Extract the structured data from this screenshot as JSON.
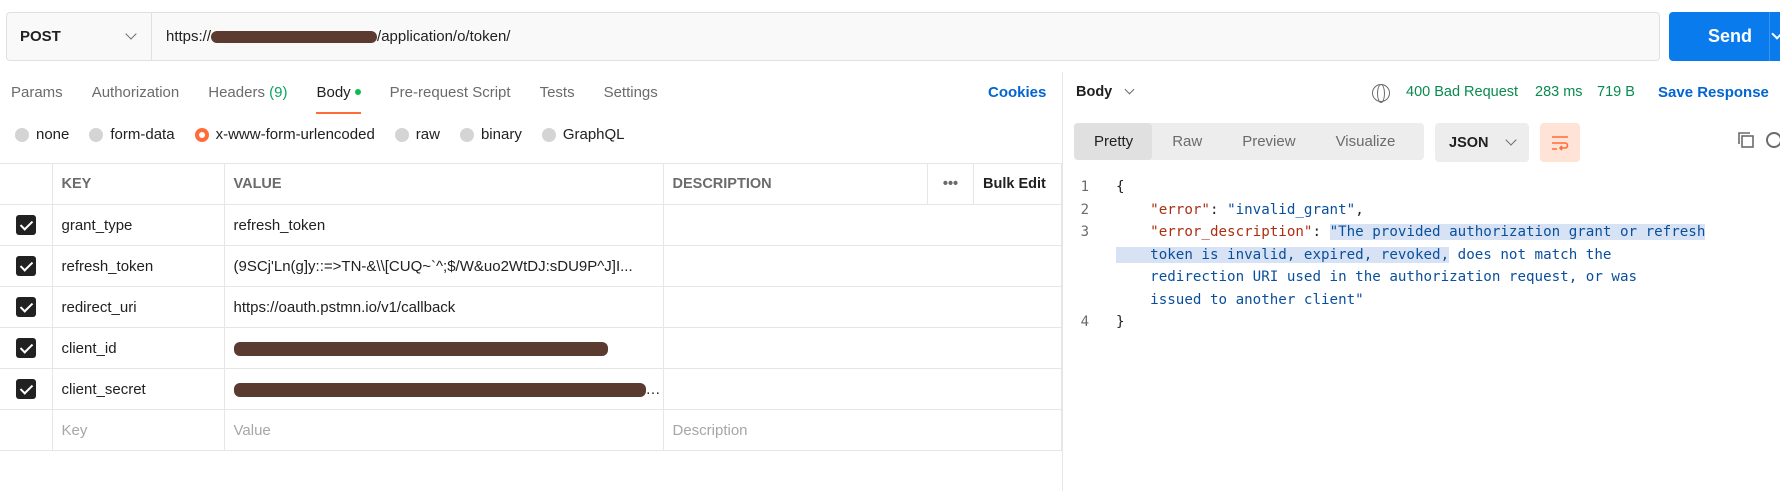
{
  "request": {
    "method": "POST",
    "url_prefix": "https://",
    "url_suffix": "/application/o/token/",
    "send_label": "Send"
  },
  "tabs": {
    "params": "Params",
    "authorization": "Authorization",
    "headers": "Headers",
    "headers_count": "(9)",
    "body": "Body",
    "prerequest": "Pre-request Script",
    "tests": "Tests",
    "settings": "Settings",
    "cookies": "Cookies"
  },
  "body_types": [
    "none",
    "form-data",
    "x-www-form-urlencoded",
    "raw",
    "binary",
    "GraphQL"
  ],
  "body_type_selected": "x-www-form-urlencoded",
  "table": {
    "headers": {
      "key": "KEY",
      "value": "VALUE",
      "description": "DESCRIPTION",
      "more": "•••",
      "bulk": "Bulk Edit"
    },
    "rows": [
      {
        "key": "grant_type",
        "value": "refresh_token",
        "checked": true
      },
      {
        "key": "refresh_token",
        "value": "(9SCj'Ln(g]y::=>TN-&\\\\[CUQ~`^;$/W&uo2WtDJ:sDU9P^J]I...",
        "checked": true
      },
      {
        "key": "redirect_uri",
        "value": "https://oauth.pstmn.io/v1/callback",
        "checked": true
      },
      {
        "key": "client_id",
        "value": "",
        "checked": true
      },
      {
        "key": "client_secret",
        "value": "...",
        "checked": true
      }
    ],
    "placeholders": {
      "key": "Key",
      "value": "Value",
      "description": "Description"
    }
  },
  "response": {
    "body_label": "Body",
    "status": "400 Bad Request",
    "time": "283 ms",
    "size": "719 B",
    "save_label": "Save Response",
    "view_tabs": [
      "Pretty",
      "Raw",
      "Preview",
      "Visualize"
    ],
    "active_view": "Pretty",
    "format": "JSON",
    "lines": {
      "l1": "1",
      "l2": "2",
      "l3": "3",
      "l4": "4",
      "open_brace": "{",
      "error_key": "\"error\"",
      "error_val": "\"invalid_grant\"",
      "desc_key": "\"error_description\"",
      "desc_val_1a": "\"The provided authorization grant or refresh",
      "desc_val_2a": "token is invalid, expired, revoked,",
      "desc_val_2b": " does not match the",
      "desc_val_3": "redirection URI used in the authorization request, or was",
      "desc_val_4": "issued to another client\"",
      "close_brace": "}"
    }
  },
  "colors": {
    "accent": "#ff6c37",
    "send": "#097bed",
    "status_ok": "#0a8a4f",
    "link": "#0265d2"
  }
}
